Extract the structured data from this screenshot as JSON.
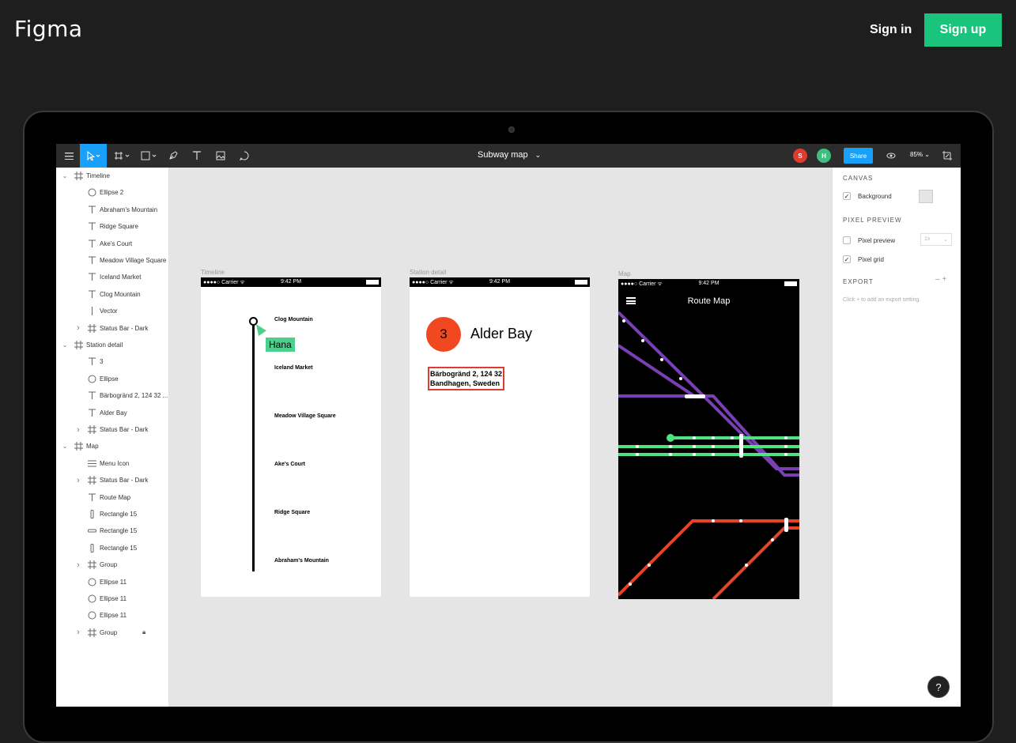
{
  "site": {
    "logo": "Figma",
    "signin_label": "Sign in",
    "signup_label": "Sign up",
    "help_label": "?"
  },
  "toolbar": {
    "menu_icon": "hamburger-icon",
    "tools": [
      "move-tool-icon",
      "frame-tool-icon",
      "shape-tool-icon",
      "pen-tool-icon",
      "text-tool-icon",
      "image-tool-icon",
      "comment-tool-icon"
    ],
    "file_title": "Subway map",
    "file_title_chevron": "⌄",
    "avatars": [
      {
        "initial": "S",
        "color": "#e03b2f"
      },
      {
        "initial": "H",
        "color": "#3fbf7f"
      }
    ],
    "share_label": "Share",
    "zoom": "85% ⌄"
  },
  "layers": [
    {
      "label": "Timeline",
      "icon": "frame-icon",
      "depth": 0,
      "expand": "down"
    },
    {
      "label": "Ellipse 2",
      "icon": "ellipse-icon",
      "depth": 1
    },
    {
      "label": "Abraham's Mountain",
      "icon": "text-icon",
      "depth": 1
    },
    {
      "label": "Ridge Square",
      "icon": "text-icon",
      "depth": 1
    },
    {
      "label": "Ake's Court",
      "icon": "text-icon",
      "depth": 1
    },
    {
      "label": "Meadow Village Square",
      "icon": "text-icon",
      "depth": 1
    },
    {
      "label": "Iceland Market",
      "icon": "text-icon",
      "depth": 1
    },
    {
      "label": "Clog Mountain",
      "icon": "text-icon",
      "depth": 1
    },
    {
      "label": "Vector",
      "icon": "vector-icon",
      "depth": 1
    },
    {
      "label": "Status Bar - Dark",
      "icon": "frame-icon",
      "depth": 1,
      "expand": "right"
    },
    {
      "label": "Station detail",
      "icon": "frame-icon",
      "depth": 0,
      "expand": "down"
    },
    {
      "label": "3",
      "icon": "text-icon",
      "depth": 1
    },
    {
      "label": "Ellipse",
      "icon": "ellipse-icon",
      "depth": 1
    },
    {
      "label": "Bärbogränd 2, 124 32 ...",
      "icon": "text-icon",
      "depth": 1
    },
    {
      "label": "Alder Bay",
      "icon": "text-icon",
      "depth": 1
    },
    {
      "label": "Status Bar - Dark",
      "icon": "frame-icon",
      "depth": 1,
      "expand": "right"
    },
    {
      "label": "Map",
      "icon": "frame-icon",
      "depth": 0,
      "expand": "down"
    },
    {
      "label": "Menu Icon",
      "icon": "menu-icon",
      "depth": 1
    },
    {
      "label": "Status Bar - Dark",
      "icon": "frame-icon",
      "depth": 1,
      "expand": "right"
    },
    {
      "label": "Route Map",
      "icon": "text-icon",
      "depth": 1
    },
    {
      "label": "Rectangle 15",
      "icon": "rectangle-vertical-icon",
      "depth": 1
    },
    {
      "label": "Rectangle 15",
      "icon": "rectangle-horizontal-icon",
      "depth": 1
    },
    {
      "label": "Rectangle 15",
      "icon": "rectangle-vertical-icon",
      "depth": 1
    },
    {
      "label": "Group",
      "icon": "frame-icon",
      "depth": 1,
      "expand": "right"
    },
    {
      "label": "Ellipse 11",
      "icon": "ellipse-icon",
      "depth": 1
    },
    {
      "label": "Ellipse 11",
      "icon": "ellipse-icon",
      "depth": 1
    },
    {
      "label": "Ellipse 11",
      "icon": "ellipse-icon",
      "depth": 1
    },
    {
      "label": "Group",
      "icon": "frame-icon",
      "depth": 1,
      "expand": "right",
      "locked": true
    }
  ],
  "canvas": {
    "frames": {
      "timeline": {
        "label": "Timeline",
        "status": {
          "carrier": "●●●●○ Carrier ᯤ",
          "time": "9:42 PM"
        },
        "stations": [
          "Clog Mountain",
          "Iceland Market",
          "Meadow Village Square",
          "Ake's Court",
          "Ridge Square",
          "Abraham's Mountain"
        ],
        "cursor_user": "Hana"
      },
      "station_detail": {
        "label": "Station detail",
        "status": {
          "carrier": "●●●●○ Carrier ᯤ",
          "time": "9:42 PM"
        },
        "number": "3",
        "title": "Alder Bay",
        "address_line1": "Bärbogränd 2, 124 32",
        "address_line2": "Bandhagen, Sweden"
      },
      "map": {
        "label": "Map",
        "status": {
          "carrier": "●●●●○ Carrier ᯤ",
          "time": "9:42 PM"
        },
        "title": "Route Map",
        "colors": {
          "purple": "#7a3fb5",
          "green": "#4ee37e",
          "red": "#e5432a"
        }
      }
    }
  },
  "properties": {
    "canvas_heading": "CANVAS",
    "background_label": "Background",
    "pixel_preview_heading": "PIXEL PREVIEW",
    "pixel_preview_label": "Pixel preview",
    "pixel_preview_scale": "1x",
    "pixel_grid_label": "Pixel grid",
    "export_heading": "EXPORT",
    "export_buttons": "–  +",
    "export_hint": "Click + to add an export setting."
  }
}
